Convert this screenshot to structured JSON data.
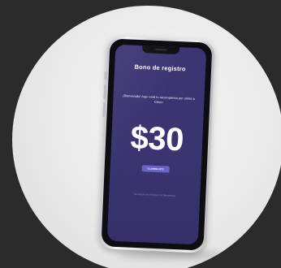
{
  "screen": {
    "title": "Bono de registro",
    "subtitle": "¡Bienvenido! Aquí está tu recompensa por unirte a Chino",
    "amount": "$30",
    "button_label": "CLAIMING BTC",
    "footnote": "Se aplican los términos de Bienvenida"
  },
  "colors": {
    "screen_background": "#3a3470",
    "button": "#6a62c8",
    "page_background": "#2b2b2b",
    "photo_background": "#ececec"
  }
}
